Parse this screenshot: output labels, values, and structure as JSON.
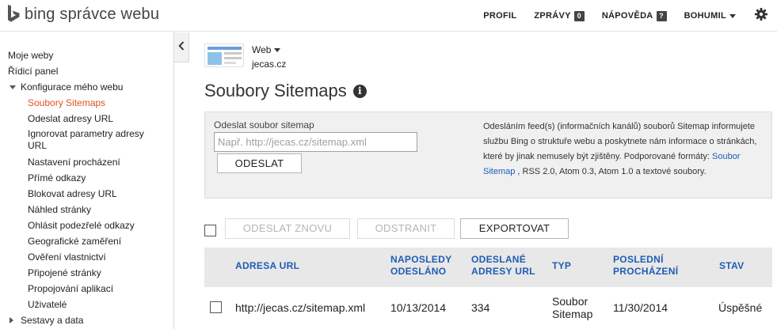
{
  "header": {
    "app_name": "bing správce webu",
    "nav": {
      "profile": "PROFIL",
      "messages": "ZPRÁVY",
      "messages_count": "0",
      "help": "NÁPOVĚDA",
      "help_badge": "?",
      "user": "BOHUMIL"
    },
    "icons": {
      "logo": "bing-logo-icon",
      "settings": "gear-icon"
    }
  },
  "sidebar": {
    "items": [
      {
        "label": "Moje weby"
      },
      {
        "label": "Řídicí panel"
      },
      {
        "label": "Konfigurace mého webu"
      },
      {
        "label": "Soubory Sitemaps"
      },
      {
        "label": "Odeslat adresy URL"
      },
      {
        "label": "Ignorovat parametry adresy URL"
      },
      {
        "label": "Nastavení procházení"
      },
      {
        "label": "Přímé odkazy"
      },
      {
        "label": "Blokovat adresy URL"
      },
      {
        "label": "Náhled stránky"
      },
      {
        "label": "Ohlásit podezřelé odkazy"
      },
      {
        "label": "Geografické zaměření"
      },
      {
        "label": "Ověření vlastnictví"
      },
      {
        "label": "Připojené stránky"
      },
      {
        "label": "Propojování aplikací"
      },
      {
        "label": "Uživatelé"
      },
      {
        "label": "Sestavy a data"
      }
    ],
    "active_item": "Soubory Sitemaps"
  },
  "site_selector": {
    "type": "Web",
    "site": "jecas.cz"
  },
  "page": {
    "title": "Soubory Sitemaps"
  },
  "submit": {
    "label": "Odeslat soubor sitemap",
    "placeholder": "Např. http://jecas.cz/sitemap.xml",
    "value": "",
    "button": "ODESLAT",
    "desc_before": "Odesláním feed(s) (informačních kanálů) souborů Sitemap informujete službu Bing o struktuře webu a poskytnete nám informace o stránkách, které by jinak nemusely být zjištěny. Podporované formáty: ",
    "desc_link": "Soubor Sitemap",
    "desc_after": " , RSS 2.0, Atom 0.3, Atom 1.0 a textové soubory."
  },
  "toolbar": {
    "resubmit": "ODESLAT ZNOVU",
    "delete": "ODSTRANIT",
    "export": "EXPORTOVAT"
  },
  "table": {
    "columns": [
      "ADRESA URL",
      "NAPOSLEDY ODESLÁNO",
      "ODESLANÉ ADRESY URL",
      "TYP",
      "POSLEDNÍ PROCHÁZENÍ",
      "STAV"
    ],
    "rows": [
      {
        "url": "http://jecas.cz/sitemap.xml",
        "last_submitted": "10/13/2014",
        "urls_submitted": "334",
        "type": "Soubor Sitemap",
        "last_crawled": "11/30/2014",
        "status": "Úspěšné"
      }
    ]
  }
}
